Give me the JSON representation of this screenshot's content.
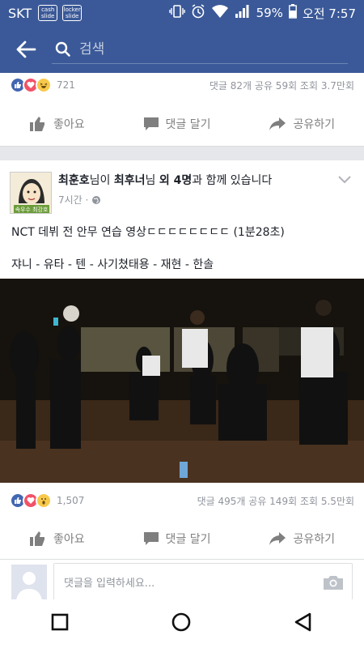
{
  "status": {
    "carrier": "SKT",
    "badge1": [
      "cash",
      "slide"
    ],
    "badge2": [
      "locker",
      "slide"
    ],
    "battery": "59%",
    "time": "오전 7:57"
  },
  "search": {
    "placeholder": "검색"
  },
  "post1": {
    "reaction_count": "721",
    "stats": "댓글 82개 공유 59회 조회 3.7만회"
  },
  "actions": {
    "like": "좋아요",
    "comment": "댓글 달기",
    "share": "공유하기"
  },
  "post2": {
    "author": "최훈호",
    "mid1": "님이 ",
    "tagged": "최후너",
    "mid2": "님 ",
    "others": "외 4명",
    "mid3": "과 함께 있습니다",
    "time": "7시간 ·",
    "text1": "NCT 데뷔 전 안무 연습 영상ㄷㄷㄷㄷㄷㄷㄷㄷ (1분28초)",
    "text2": "쟈니 - 유타 - 텐 - 사기쳤태용 - 재현 - 한솔",
    "reaction_count": "1,507",
    "stats": "댓글 495개 공유 149회 조회 5.5만회",
    "comment_placeholder": "댓글을 입력하세요..."
  },
  "colors": {
    "brand": "#3b5998",
    "like": "#4267b2",
    "love": "#f25268",
    "haha": "#f7c94b"
  }
}
